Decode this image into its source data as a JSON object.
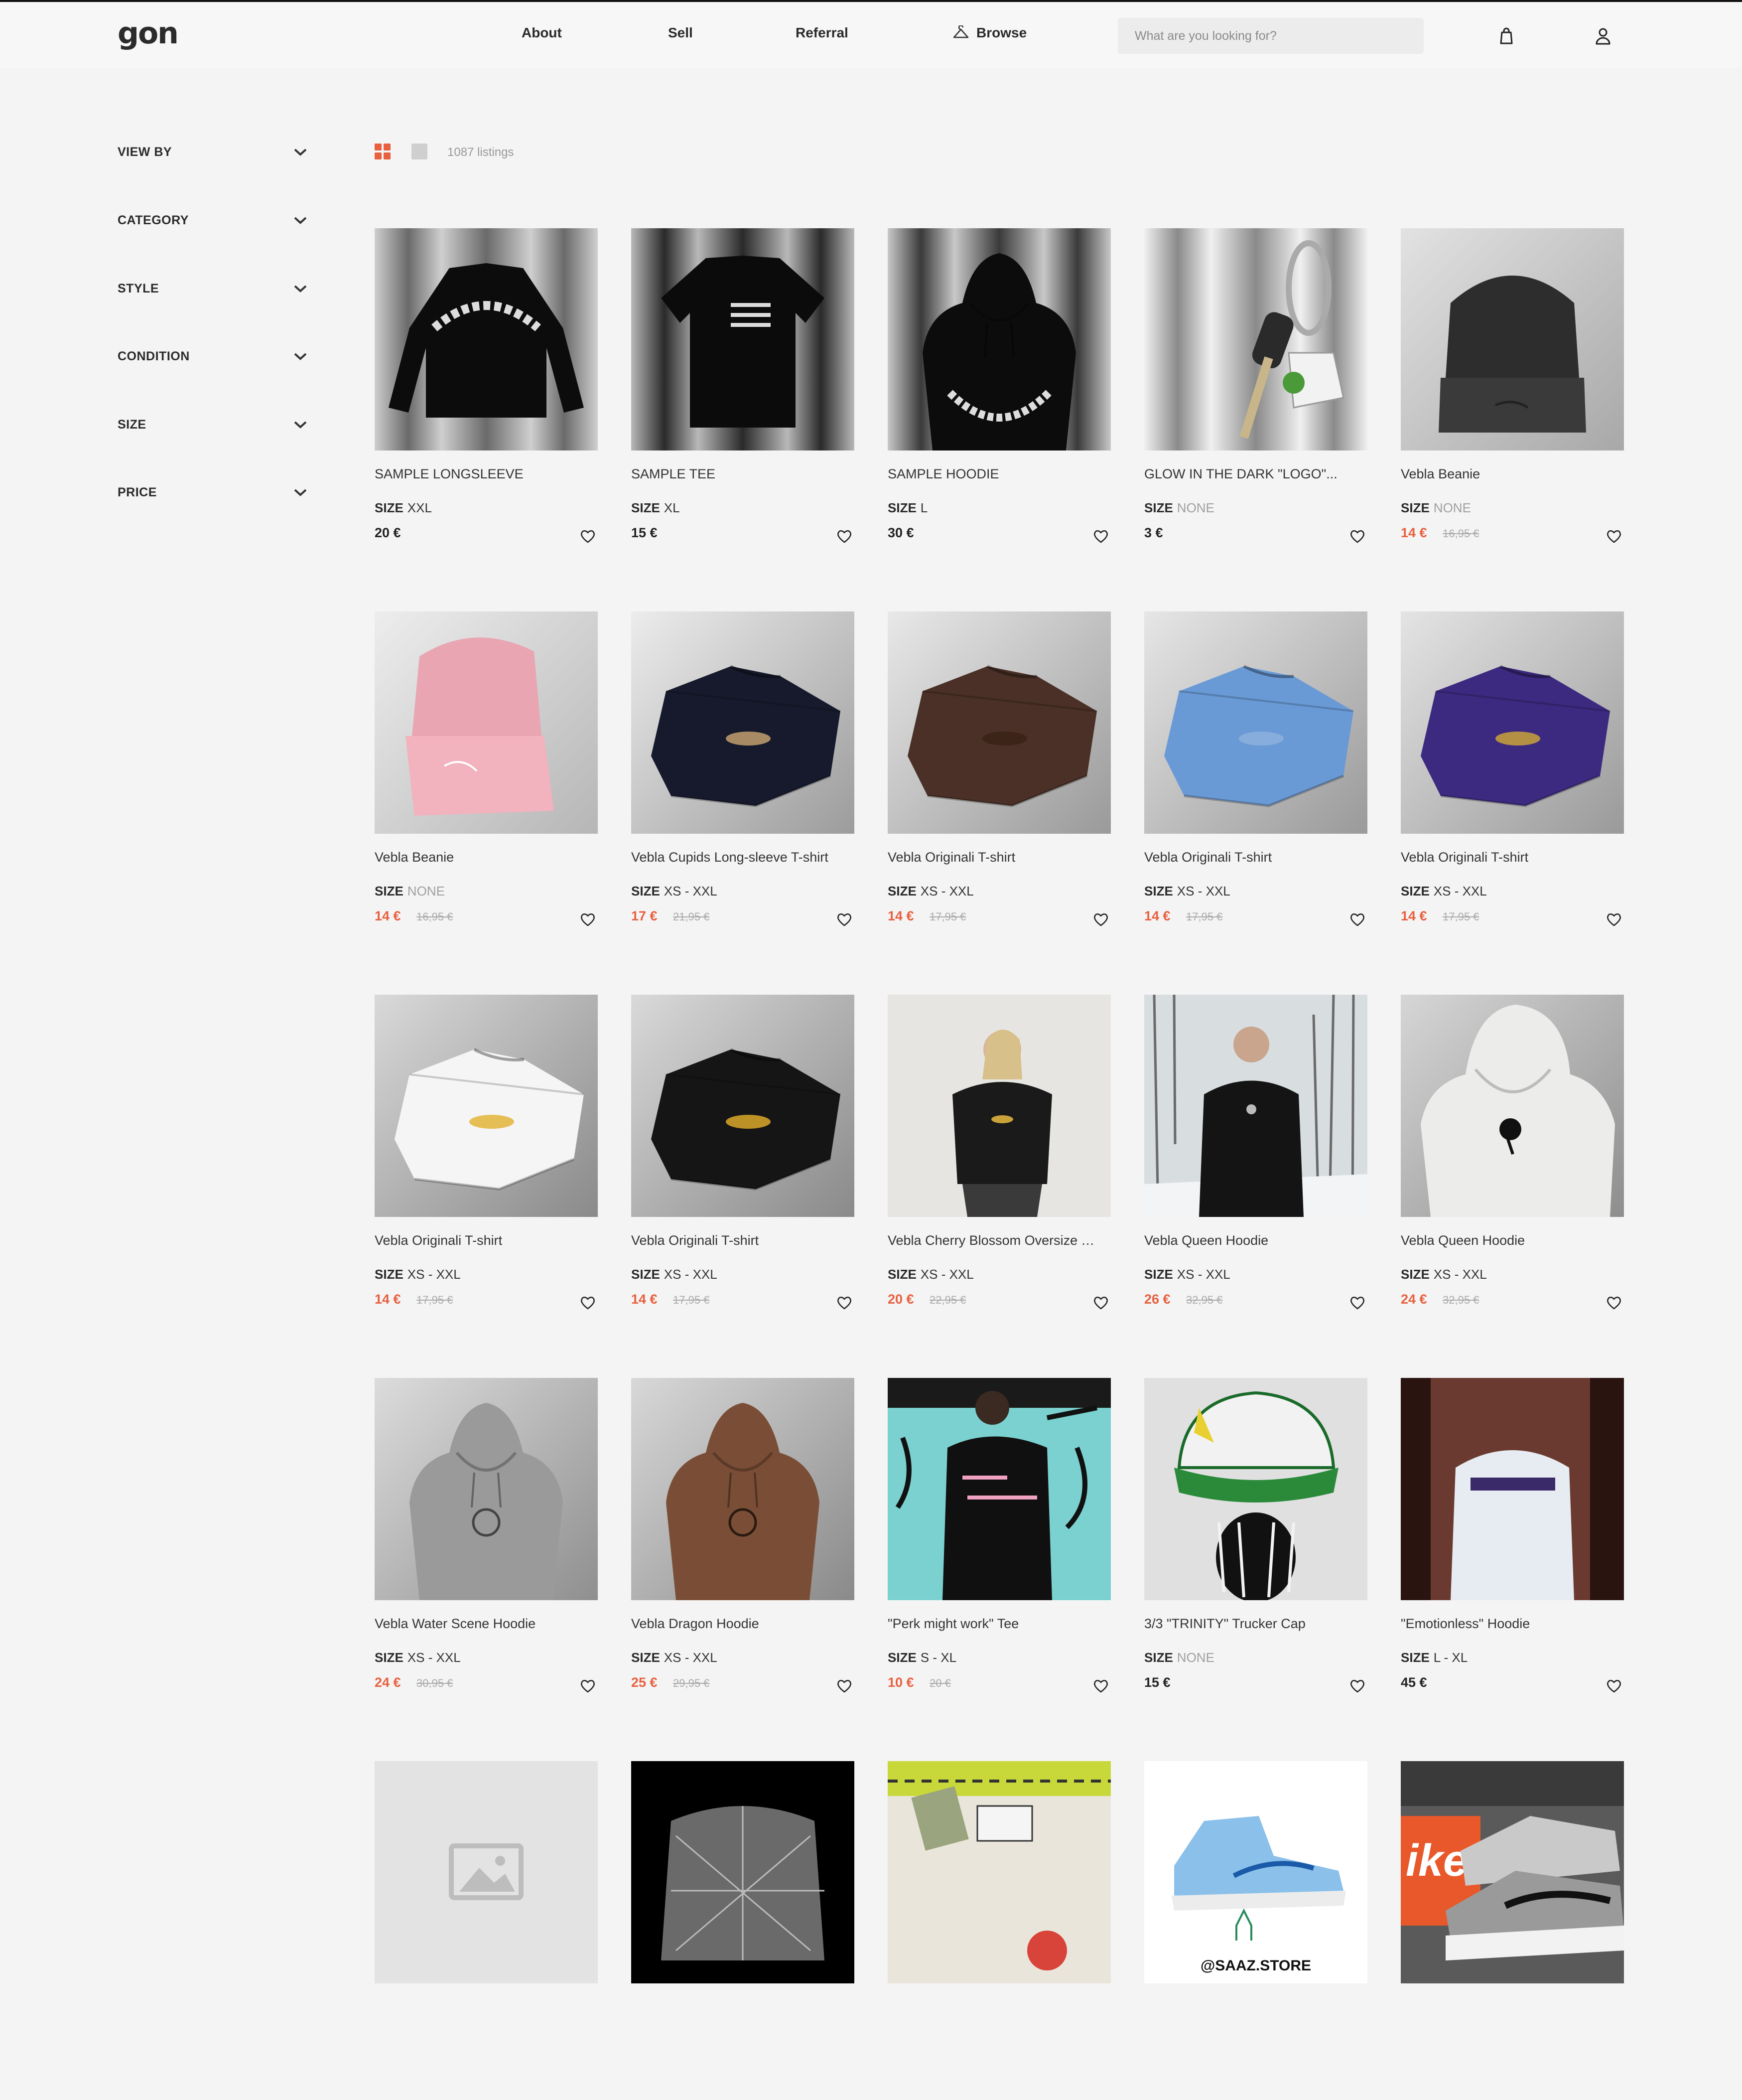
{
  "header": {
    "logo": "gon",
    "nav": {
      "about": "About",
      "sell": "Sell",
      "referral": "Referral",
      "browse": "Browse"
    },
    "search_placeholder": "What are you looking for?",
    "icons": {
      "browse": "hanger-icon",
      "bag": "shopping-bag-icon",
      "account": "user-icon"
    }
  },
  "filters": [
    "VIEW BY",
    "CATEGORY",
    "STYLE",
    "CONDITION",
    "SIZE",
    "PRICE"
  ],
  "toolbar": {
    "count": "1087 listings",
    "active_view": "grid",
    "accent": "#e8603f"
  },
  "colors": {
    "accent": "#e8603f",
    "background": "#f4f4f4",
    "text": "#222222",
    "muted": "#a0a0a0"
  },
  "size_label": "SIZE",
  "products": [
    {
      "title": "SAMPLE LONGSLEEVE",
      "size": "XXL",
      "price": "20 €",
      "old_price": "",
      "img": "longsleeve-black"
    },
    {
      "title": "SAMPLE TEE",
      "size": "XL",
      "price": "15 €",
      "old_price": "",
      "img": "tee-black"
    },
    {
      "title": "SAMPLE HOODIE",
      "size": "L",
      "price": "30 €",
      "old_price": "",
      "img": "hoodie-black"
    },
    {
      "title": "GLOW IN THE DARK \"LOGO\"...",
      "size": "NONE",
      "price": "3 €",
      "old_price": "",
      "img": "keychain"
    },
    {
      "title": "Vebla Beanie",
      "size": "NONE",
      "price": "14 €",
      "old_price": "16,95 €",
      "img": "beanie-black"
    },
    {
      "title": "Vebla Beanie",
      "size": "NONE",
      "price": "14 €",
      "old_price": "16,95 €",
      "img": "beanie-pink"
    },
    {
      "title": "Vebla Cupids Long-sleeve T-shirt",
      "size": "XS - XXL",
      "price": "17 €",
      "old_price": "21,95 €",
      "img": "tshirt-navy"
    },
    {
      "title": "Vebla Originali T-shirt",
      "size": "XS - XXL",
      "price": "14 €",
      "old_price": "17,95 €",
      "img": "tshirt-brown"
    },
    {
      "title": "Vebla Originali T-shirt",
      "size": "XS - XXL",
      "price": "14 €",
      "old_price": "17,95 €",
      "img": "tshirt-blue"
    },
    {
      "title": "Vebla Originali T-shirt",
      "size": "XS - XXL",
      "price": "14 €",
      "old_price": "17,95 €",
      "img": "tshirt-purple"
    },
    {
      "title": "Vebla Originali T-shirt",
      "size": "XS - XXL",
      "price": "14 €",
      "old_price": "17,95 €",
      "img": "tshirt-white"
    },
    {
      "title": "Vebla Originali T-shirt",
      "size": "XS - XXL",
      "price": "14 €",
      "old_price": "17,95 €",
      "img": "tshirt-black"
    },
    {
      "title": "Vebla Cherry Blossom Oversize T...",
      "size": "XS - XXL",
      "price": "20 €",
      "old_price": "22,95 €",
      "img": "model-woman"
    },
    {
      "title": "Vebla Queen Hoodie",
      "size": "XS - XXL",
      "price": "26 €",
      "old_price": "32,95 €",
      "img": "model-man-snow"
    },
    {
      "title": "Vebla Queen Hoodie",
      "size": "XS - XXL",
      "price": "24 €",
      "old_price": "32,95 €",
      "img": "hoodie-white"
    },
    {
      "title": "Vebla Water Scene Hoodie",
      "size": "XS - XXL",
      "price": "24 €",
      "old_price": "30,95 €",
      "img": "hoodie-grey"
    },
    {
      "title": "Vebla Dragon Hoodie",
      "size": "XS - XXL",
      "price": "25 €",
      "old_price": "29,95 €",
      "img": "hoodie-brown"
    },
    {
      "title": "\"Perk might work\" Tee",
      "size": "S - XL",
      "price": "10 €",
      "old_price": "20 €",
      "img": "graffiti-tee"
    },
    {
      "title": "3/3 \"TRINITY\" Trucker Cap",
      "size": "NONE",
      "price": "15 €",
      "old_price": "",
      "img": "trucker-cap"
    },
    {
      "title": "\"Emotionless\" Hoodie",
      "size": "L - XL",
      "price": "45 €",
      "old_price": "",
      "img": "hoodie-emotionless"
    },
    {
      "title": "",
      "size": "",
      "price": "",
      "old_price": "",
      "img": "placeholder"
    },
    {
      "title": "",
      "size": "",
      "price": "",
      "old_price": "",
      "img": "jacket-pattern"
    },
    {
      "title": "",
      "size": "",
      "price": "",
      "old_price": "",
      "img": "palace-box"
    },
    {
      "title": "",
      "size": "",
      "price": "",
      "old_price": "",
      "img": "sneaker-blue",
      "img_text": "@SAAZ.STORE"
    },
    {
      "title": "",
      "size": "",
      "price": "",
      "old_price": "",
      "img": "sneakers-grey",
      "img_text": "ike"
    }
  ]
}
